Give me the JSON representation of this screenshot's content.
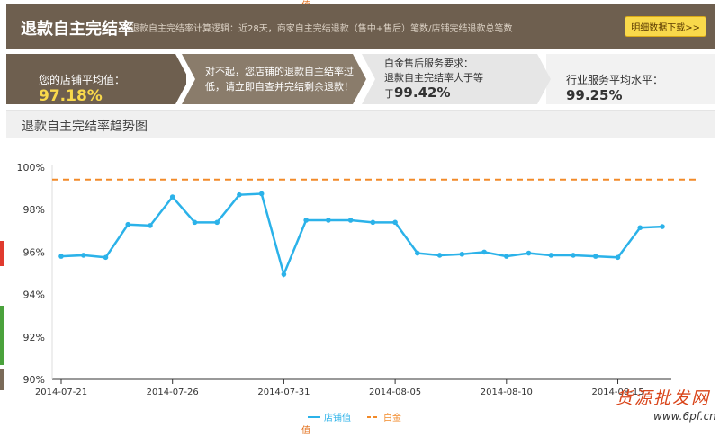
{
  "page_marker": "值",
  "header": {
    "title": "退款自主完结率",
    "desc": "退款自主完结率计算逻辑：近28天，商家自主完结退款（售中+售后）笔数/店铺完结退款总笔数",
    "download_button": "明细数据下载>>"
  },
  "stats": {
    "store_label": "您的店铺平均值：",
    "store_value": "97.18%",
    "warning": "对不起，您店铺的退款自主结率过低，请立即自查并完结剩余退款！",
    "platinum_req_1": "白金售后服务要求：",
    "platinum_req_2": "退款自主完结率大于等",
    "platinum_req_3": "于",
    "platinum_value": "99.42%",
    "industry_label": "行业服务平均水平：",
    "industry_value": "99.25%"
  },
  "section_title": "退款自主完结率趋势图",
  "chart_data": {
    "type": "line",
    "x": [
      "2014-07-21",
      "2014-07-22",
      "2014-07-23",
      "2014-07-24",
      "2014-07-25",
      "2014-07-26",
      "2014-07-27",
      "2014-07-28",
      "2014-07-29",
      "2014-07-30",
      "2014-07-31",
      "2014-08-01",
      "2014-08-02",
      "2014-08-03",
      "2014-08-04",
      "2014-08-05",
      "2014-08-06",
      "2014-08-07",
      "2014-08-08",
      "2014-08-09",
      "2014-08-10",
      "2014-08-11",
      "2014-08-12",
      "2014-08-13",
      "2014-08-14",
      "2014-08-15",
      "2014-08-16",
      "2014-08-17"
    ],
    "xticks": [
      "2014-07-21",
      "2014-07-26",
      "2014-07-31",
      "2014-08-05",
      "2014-08-10",
      "2014-08-15"
    ],
    "series": [
      {
        "name": "店铺值",
        "color": "#2bb2e9",
        "values": [
          95.8,
          95.85,
          95.75,
          97.3,
          97.25,
          98.6,
          97.4,
          97.4,
          98.7,
          98.75,
          94.95,
          97.5,
          97.5,
          97.5,
          97.4,
          97.4,
          95.95,
          95.85,
          95.9,
          96.0,
          95.8,
          95.95,
          95.85,
          95.85,
          95.8,
          95.75,
          97.15,
          97.2
        ]
      },
      {
        "name": "白金",
        "color": "#f28a29",
        "style": "dashed",
        "values": [
          99.42
        ]
      }
    ],
    "yticks": [
      "90%",
      "92%",
      "94%",
      "96%",
      "98%",
      "100%"
    ],
    "ylim": [
      90,
      100
    ],
    "legend_position": "bottom-center"
  },
  "watermark": {
    "text": "货源批发网",
    "sub": "www.6pf.cn"
  }
}
